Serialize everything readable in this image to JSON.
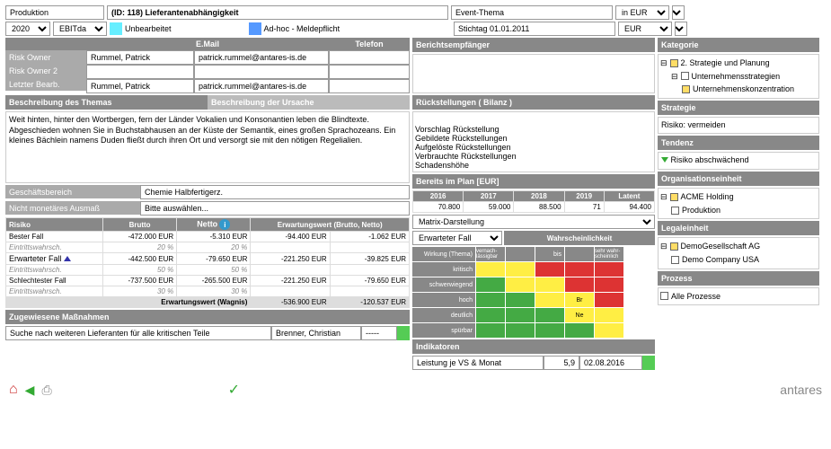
{
  "top": {
    "produktion": "Produktion",
    "id_title": "(ID: 118) Lieferantenabhängigkeit",
    "event": "Event-Thema",
    "inEUR": "in EUR",
    "year": "2020",
    "ebitda": "EBITda",
    "unbearb": "Unbearbeitet",
    "adhoc": "Ad-hoc - Meldepflicht",
    "stichtag": "Stichtag 01.01.2011",
    "eur": "EUR"
  },
  "owners": {
    "h_email": "E.Mail",
    "h_tel": "Telefon",
    "r1": "Risk Owner",
    "r2": "Risk Owner 2",
    "r3": "Letzter Bearb.",
    "name": "Rummel, Patrick",
    "email": "patrick.rummel@antares-is.de"
  },
  "desc": {
    "h1": "Beschreibung des Themas",
    "h2": "Beschreibung der Ursache",
    "body": "Weit hinten, hinter den Wortbergen, fern der Länder Vokalien und Konsonantien leben die Blindtexte. Abgeschieden wohnen Sie in Buchstabhausen an der Küste der Semantik, eines großen Sprachozeans. Ein kleines Bächlein namens Duden fließt durch ihren Ort und versorgt sie mit den nötigen Regelialien."
  },
  "gb": {
    "lbl": "Geschäftsbereich",
    "val": "Chemie Halbfertigerz."
  },
  "nma": {
    "lbl": "Nicht monetäres Ausmaß",
    "val": "Bitte auswählen..."
  },
  "risk": {
    "h": {
      "c1": "Risiko",
      "c2": "Brutto",
      "c3": "Netto",
      "c4": "Erwartungswert (Brutto, Netto)"
    },
    "rows": [
      {
        "n": "Bester Fall",
        "b": "-472.000 EUR",
        "nt": "-5.310 EUR",
        "e1": "-94.400 EUR",
        "e2": "-1.062 EUR",
        "p1": "20 %",
        "p2": "20 %"
      },
      {
        "n": "Erwarteter Fall",
        "b": "-442.500 EUR",
        "nt": "-79.650 EUR",
        "e1": "-221.250 EUR",
        "e2": "-39.825 EUR",
        "p1": "50 %",
        "p2": "50 %"
      },
      {
        "n": "Schlechtester Fall",
        "b": "-737.500 EUR",
        "nt": "-265.500 EUR",
        "e1": "-221.250 EUR",
        "e2": "-79.650 EUR",
        "p1": "30 %",
        "p2": "30 %"
      }
    ],
    "ew_lbl": "Erwartungswert (Wagnis)",
    "ew1": "-536.900 EUR",
    "ew2": "-120.537 EUR",
    "eintr": "Eintrittswahrsch."
  },
  "mass": {
    "h": "Zugewiesene Maßnahmen",
    "txt": "Suche nach weiteren Lieferanten für alle kritischen Teile",
    "who": "Brenner, Christian",
    "dash": "-----"
  },
  "be": {
    "h": "Berichtsempfänger"
  },
  "rs": {
    "h": "Rückstellungen ( Bilanz )",
    "items": [
      "Vorschlag Rückstellung",
      "Gebildete Rückstellungen",
      "Aufgelöste Rückstellungen",
      "Verbrauchte Rückstellungen",
      "Schadenshöhe"
    ]
  },
  "plan": {
    "h": "Bereits im Plan [EUR]",
    "y": [
      "2016",
      "2017",
      "2018",
      "2019",
      "Latent"
    ],
    "v": [
      "70.800",
      "59.000",
      "88.500",
      "71",
      "94.400"
    ]
  },
  "mat": {
    "lbl": "Matrix-Darstellung",
    "ef": "Erwarteter Fall",
    "wh": "Wahrscheinlichkeit",
    "wt": "Wirkung (Thema)",
    "cols": [
      "vernach-lässigbar",
      "",
      "bis",
      "",
      "sehr wahr-scheinlich"
    ],
    "rows": [
      "kritisch",
      "schwerwiegend",
      "hoch",
      "deutlich",
      "spürbar"
    ],
    "br": "Br",
    "ne": "Ne"
  },
  "ind": {
    "h": "Indikatoren",
    "txt": "Leistung je VS & Monat",
    "v": "5,9",
    "d": "02.08.2016"
  },
  "kat": {
    "h": "Kategorie",
    "i1": "2. Strategie und Planung",
    "i2": "Unternehmensstrategien",
    "i3": "Unternehmenskonzentration"
  },
  "str": {
    "h": "Strategie",
    "v": "Risiko: vermeiden"
  },
  "ten": {
    "h": "Tendenz",
    "v": "Risiko abschwächend"
  },
  "org": {
    "h": "Organisationseinheit",
    "i1": "ACME Holding",
    "i2": "Produktion"
  },
  "leg": {
    "h": "Legaleinheit",
    "i1": "DemoGesellschaft AG",
    "i2": "Demo Company USA"
  },
  "pro": {
    "h": "Prozess",
    "i1": "Alle Prozesse"
  },
  "logo": "antares"
}
